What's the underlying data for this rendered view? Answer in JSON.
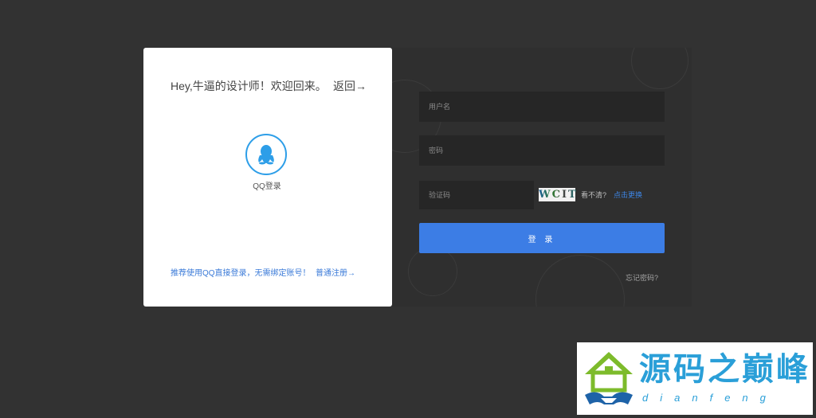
{
  "login": {
    "greeting": "Hey,牛逼的设计师！欢迎回来。",
    "back_link": "返回→",
    "qq_login_label": "QQ登录",
    "recommend_text": "推荐使用QQ直接登录，无需绑定账号！",
    "register_link": "普通注册→"
  },
  "form": {
    "username_placeholder": "用户名",
    "password_placeholder": "密码",
    "captcha_placeholder": "验证码",
    "captcha_text": "WCIT",
    "unclear_text": "看不清?",
    "refresh_link": "点击更换",
    "submit_label": "登 录",
    "forgot_password": "忘记密码?"
  },
  "watermark": {
    "title": "源码之巅峰",
    "subtitle": "dianfeng"
  },
  "colors": {
    "background": "#323232",
    "primary_button": "#3c7de5",
    "link": "#3a7ad8",
    "qq_blue": "#2d9ee8",
    "watermark_blue": "#2a9fd8",
    "watermark_green": "#7dbb2b"
  },
  "icons": {
    "qq": "qq-penguin-icon",
    "logo": "house-handshake-logo"
  }
}
